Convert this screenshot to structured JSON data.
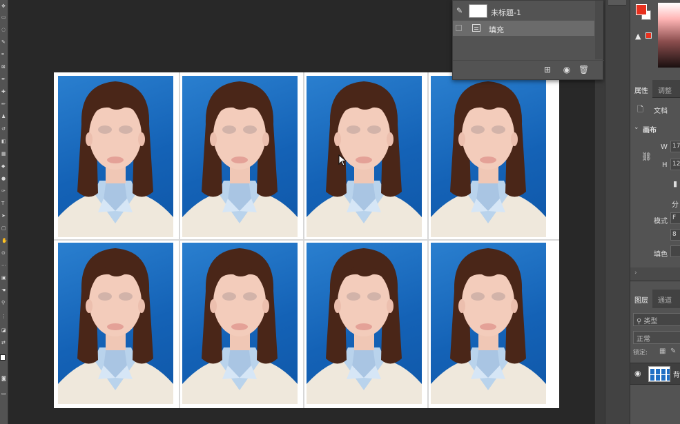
{
  "floating_panel": {
    "layer_name": "未标题-1",
    "fill_label": "填充"
  },
  "right_panel": {
    "properties_tab": "属性",
    "adjustments_tab": "调整",
    "document_label": "文档",
    "canvas_section": "画布",
    "width_label": "W",
    "width_value": "17",
    "height_label": "H",
    "height_value": "12",
    "resolution_partial": "分",
    "mode_label": "模式",
    "mode_value": "F",
    "depth_value": "8",
    "fill_color_label": "填色",
    "layers_tab": "图层",
    "channels_tab": "通道",
    "layer_filter": "类型",
    "blend_mode": "正常",
    "lock_label": "锁定:",
    "layer_name_partial": "背"
  },
  "colors": {
    "foreground": "#e8311f",
    "background": "#ffffff",
    "photo_background": "#1462b6"
  }
}
